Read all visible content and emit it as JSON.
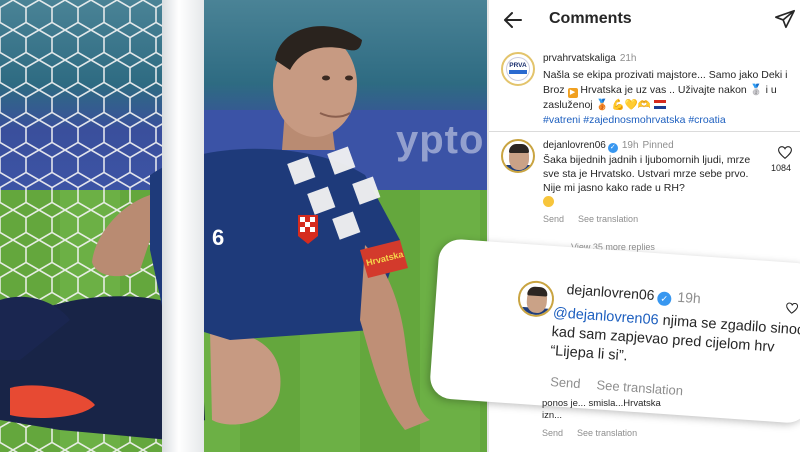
{
  "photo": {
    "background_text": "ypto",
    "jersey_number": "6",
    "armband_text": "Hrvatska"
  },
  "header": {
    "title": "Comments"
  },
  "caption": {
    "username": "prvahrvatskaliga",
    "time": "21h",
    "avatar_text": "PRVA",
    "text_before_box": "Našla se ekipa prozivati majstore... Samo jako Deki i Broz ",
    "text_after_box": " Hrvatska je uz vas .. Uživajte nakon ",
    "text_mid": " i u zasluženoj ",
    "hashtags": "#vatreni #zajednosmohrvatska #croatia"
  },
  "pinned_comment": {
    "username": "dejanlovren06",
    "time": "19h",
    "pinned_label": "Pinned",
    "text": "Šaka bijednih jadnih i ljubomornih ljudi, mrze sve sta je Hrvatsko. Ustvari mrze sebe prvo. Nije mi jasno kako rade u RH?",
    "likes": "1084",
    "send_label": "Send",
    "translation_label": "See translation",
    "view_replies": "View 35 more replies"
  },
  "reply_overlay": {
    "username": "dejanlovren06",
    "time": "19h",
    "mention": "@dejanlovren06",
    "text": " njima se zgadilo sinoc kad sam zapjevao pred cijelom hrv “Lijepa li si”.",
    "send_label": "Send",
    "translation_label": "See translation"
  },
  "partial_comment": {
    "text": "ponos je... smisla...Hrvatska izn...",
    "send_label": "Send",
    "translation_label": "See translation"
  },
  "colors": {
    "link": "#1d5fbf",
    "muted": "#8e8e8e",
    "verified": "#3897f0",
    "jersey_blue": "#1e3a7a",
    "grass": "#64a73d"
  },
  "icons": [
    "back-arrow-icon",
    "send-icon",
    "verified-icon",
    "heart-icon"
  ]
}
